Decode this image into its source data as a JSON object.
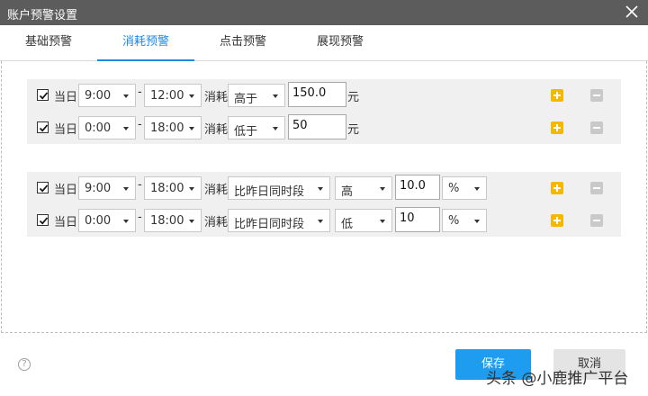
{
  "window": {
    "title": "账户预警设置"
  },
  "tabs": [
    {
      "label": "基础预警"
    },
    {
      "label": "消耗预警"
    },
    {
      "label": "点击预警"
    },
    {
      "label": "展现预警"
    }
  ],
  "active_tab": 1,
  "common": {
    "day_label": "当日",
    "dash": "-",
    "consume_label": "消耗",
    "yuan_unit": "元"
  },
  "rules_absolute": [
    {
      "checked": true,
      "start": "9:00",
      "end": "12:00",
      "compare": "高于",
      "value": "150.0"
    },
    {
      "checked": true,
      "start": "0:00",
      "end": "18:00",
      "compare": "低于",
      "value": "50"
    }
  ],
  "rules_relative": [
    {
      "checked": true,
      "start": "9:00",
      "end": "18:00",
      "basis": "比昨日同时段",
      "direction": "高",
      "value": "10.0",
      "unit": "%"
    },
    {
      "checked": true,
      "start": "0:00",
      "end": "18:00",
      "basis": "比昨日同时段",
      "direction": "低",
      "value": "10",
      "unit": "%"
    }
  ],
  "footer": {
    "help": "?",
    "save_label": "保存",
    "cancel_label": "取消"
  },
  "watermark": "头条 @小鹿推广平台",
  "colors": {
    "accent": "#1e88e5",
    "save_button": "#1e9cf0",
    "add_icon": "#f5b800",
    "titlebar": "#5c5c5c"
  }
}
